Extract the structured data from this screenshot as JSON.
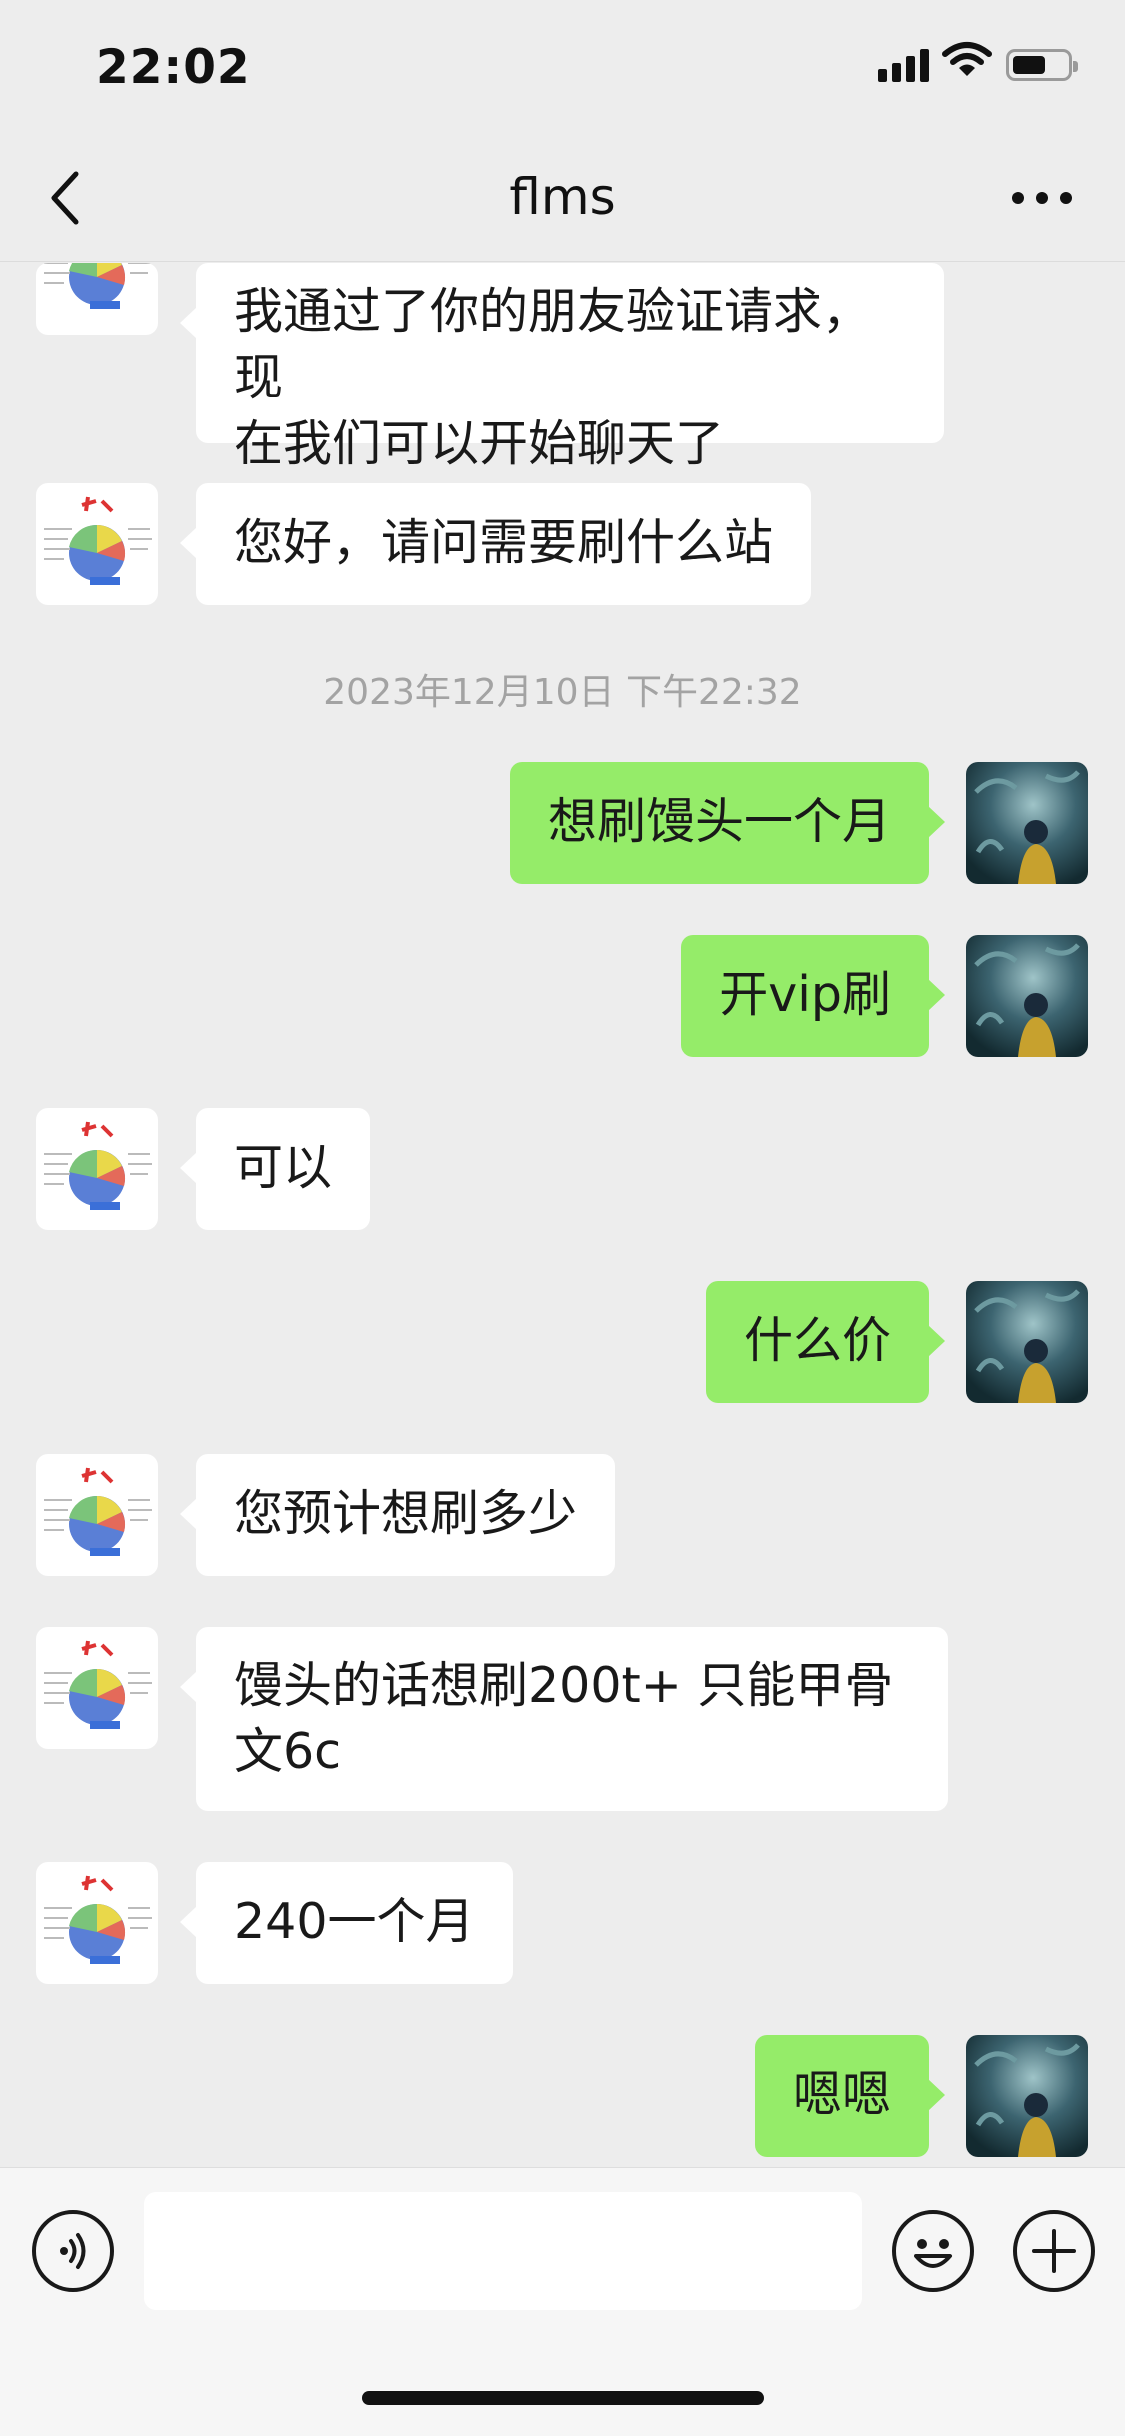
{
  "status_bar": {
    "time": "22:02"
  },
  "header": {
    "title": "flms"
  },
  "messages": [
    {
      "side": "in",
      "text_lines": [
        "我通过了你的朋友验证请求，现",
        "在我们可以开始聊天了"
      ]
    },
    {
      "side": "in",
      "text": "您好，请问需要刷什么站"
    },
    {
      "timestamp": "2023年12月10日 下午22:32"
    },
    {
      "side": "out",
      "text": "想刷馒头一个月"
    },
    {
      "side": "out",
      "text": "开vip刷"
    },
    {
      "side": "in",
      "text": "可以"
    },
    {
      "side": "out",
      "text": "什么价"
    },
    {
      "side": "in",
      "text": "您预计想刷多少"
    },
    {
      "side": "in",
      "text_lines": [
        "馒头的话想刷200t+ 只能甲骨",
        "文6c"
      ]
    },
    {
      "side": "in",
      "text": "240一个月"
    },
    {
      "side": "out",
      "text": "嗯嗯"
    }
  ],
  "input_bar": {
    "text": ""
  },
  "colors": {
    "background": "#ededed",
    "incoming_bubble": "#ffffff",
    "outgoing_bubble": "#95ec69",
    "timestamp": "#a3a3a3"
  },
  "icons": [
    "back-arrow-icon",
    "more-dots-icon",
    "voice-icon",
    "emoji-icon",
    "plus-icon"
  ]
}
